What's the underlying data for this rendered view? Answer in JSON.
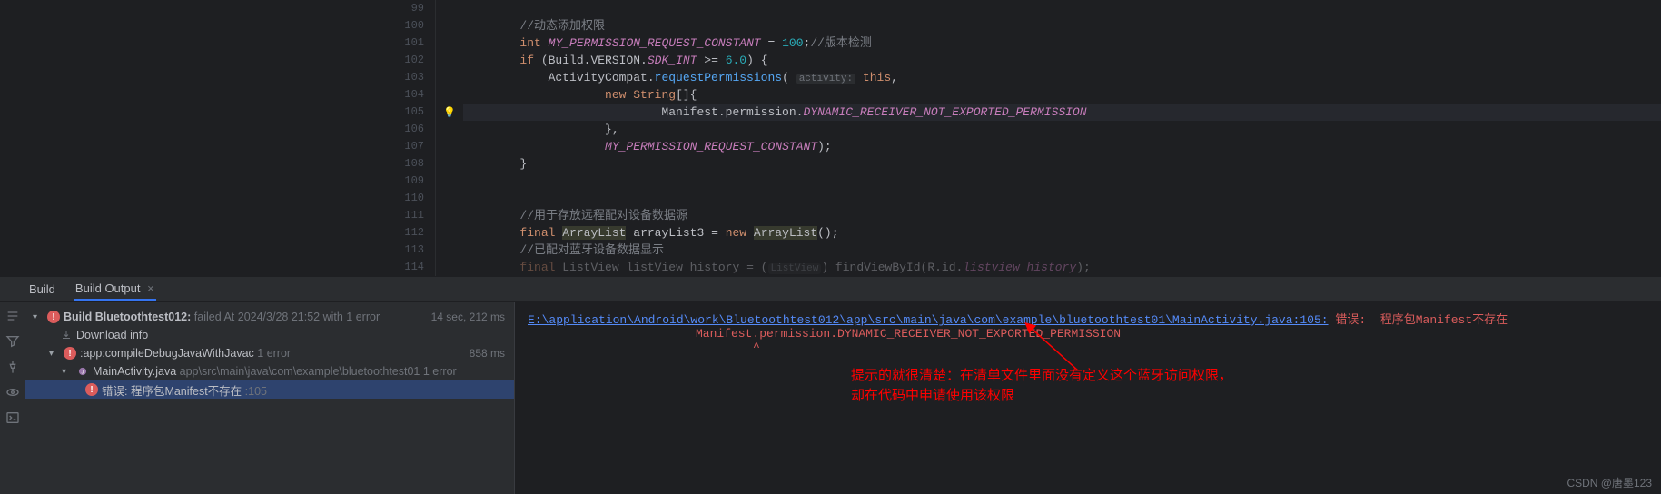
{
  "editor": {
    "lines": [
      {
        "n": 99,
        "html": ""
      },
      {
        "n": 100,
        "html": "        <span class='c-comment'>//动态添加权限</span>"
      },
      {
        "n": 101,
        "html": "        <span class='c-keyword'>int</span> <span class='c-const'>MY_PERMISSION_REQUEST_CONSTANT</span> = <span class='c-num'>100</span>;<span class='c-comment'>//版本检测</span>"
      },
      {
        "n": 102,
        "html": "        <span class='c-keyword'>if</span> (Build.VERSION.<span class='c-const'>SDK_INT</span> &gt;= <span class='c-num'>6.0</span>) {"
      },
      {
        "n": 103,
        "html": "            ActivityCompat.<span class='c-method'>requestPermissions</span>( <span class='c-param-hint'>activity:</span> <span class='c-this'>this</span>,"
      },
      {
        "n": 104,
        "html": "                    <span class='c-keyword'>new</span> <span class='c-string-cls'>String</span>[]{"
      },
      {
        "n": 105,
        "html": "                            Manifest.permission.<span class='c-field'>DYNAMIC_RECEIVER_NOT_EXPORTED_PERMISSION</span>",
        "hl": true,
        "bulb": true
      },
      {
        "n": 106,
        "html": "                    },"
      },
      {
        "n": 107,
        "html": "                    <span class='c-const'>MY_PERMISSION_REQUEST_CONSTANT</span>);"
      },
      {
        "n": 108,
        "html": "        }"
      },
      {
        "n": 109,
        "html": ""
      },
      {
        "n": 110,
        "html": ""
      },
      {
        "n": 111,
        "html": "        <span class='c-comment'>//用于存放远程配对设备数据源</span>"
      },
      {
        "n": 112,
        "html": "        <span class='c-keyword'>final</span> <span class='c-class-use'>ArrayList</span> arrayList3 = <span class='c-keyword'>new</span> <span class='c-class-use'>ArrayList</span>();"
      },
      {
        "n": 113,
        "html": "        <span class='c-comment'>//已配对蓝牙设备数据显示</span>"
      },
      {
        "n": 114,
        "html": "        <span class='c-keyword' style='opacity:.4'>final</span> <span style='opacity:.4'>ListView listView_history = (</span><span class='c-param-hint' style='opacity:.4'>ListView</span><span style='opacity:.4'>) findViewById(R.id.</span><span class='c-field' style='opacity:.4'>listview_history</span><span style='opacity:.4'>);</span>"
      }
    ]
  },
  "tabs": {
    "build": "Build",
    "output": "Build Output"
  },
  "tree": {
    "root": {
      "label": "Build Bluetoothtest012:",
      "status": "failed",
      "time_info": "At 2024/3/28 21:52 with 1 error",
      "duration": "14 sec, 212 ms"
    },
    "download": "Download info",
    "task": {
      "label": ":app:compileDebugJavaWithJavac",
      "errs": "1 error",
      "duration": "858 ms"
    },
    "file": {
      "name": "MainActivity.java",
      "path": "app\\src\\main\\java\\com\\example\\bluetoothtest01",
      "errs": "1 error"
    },
    "err": {
      "label": "错误: 程序包Manifest不存在",
      "loc": ":105"
    }
  },
  "output": {
    "file_link": "E:\\application\\Android\\work\\Bluetoothtest012\\app\\src\\main\\java\\com\\example\\bluetoothtest01\\MainActivity.java:105:",
    "err_head": " 错误:  程序包Manifest不存在",
    "err_line2": "Manifest.permission.DYNAMIC_RECEIVER_NOT_EXPORTED_PERMISSION",
    "caret": "^"
  },
  "annotation": {
    "line1": "提示的就很清楚：在清单文件里面没有定义这个蓝牙访问权限，",
    "line2": "却在代码中申请使用该权限"
  },
  "watermark": "CSDN @唐墨123"
}
